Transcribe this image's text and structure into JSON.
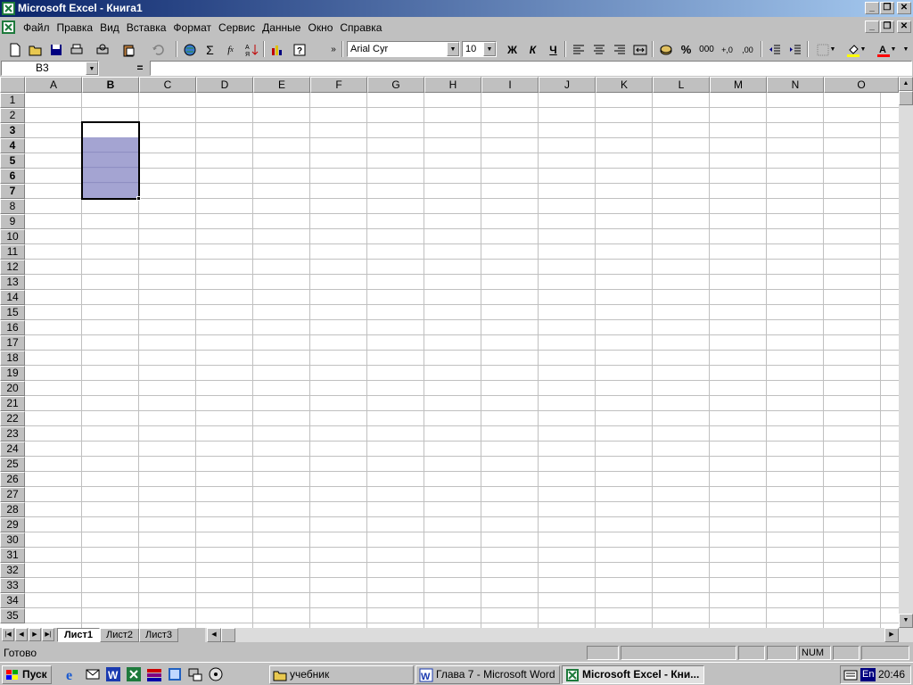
{
  "window": {
    "title": "Microsoft Excel - Книга1"
  },
  "menu": {
    "items": [
      "Файл",
      "Правка",
      "Вид",
      "Вставка",
      "Формат",
      "Сервис",
      "Данные",
      "Окно",
      "Справка"
    ]
  },
  "toolbar": {
    "font_name": "Arial Cyr",
    "font_size": "10",
    "bold_label": "Ж",
    "italic_label": "К",
    "underline_label": "Ч",
    "sum_label": "Σ",
    "percent_label": "%",
    "thousands_label": "000",
    "inc_decimal_label": "+,0",
    "dec_decimal_label": ",00",
    "more_label": "»"
  },
  "formula_bar": {
    "name_box": "B3",
    "equals": "=",
    "value": ""
  },
  "columns": [
    "A",
    "B",
    "C",
    "D",
    "E",
    "F",
    "G",
    "H",
    "I",
    "J",
    "K",
    "L",
    "M",
    "N",
    "O"
  ],
  "rows": [
    "1",
    "2",
    "3",
    "4",
    "5",
    "6",
    "7",
    "8",
    "9",
    "10",
    "11",
    "12",
    "13",
    "14",
    "15",
    "16",
    "17",
    "18",
    "19",
    "20",
    "21",
    "22",
    "23",
    "24",
    "25",
    "26",
    "27",
    "28",
    "29",
    "30",
    "31",
    "32",
    "33",
    "34",
    "35"
  ],
  "selection": {
    "active_cell": "B3",
    "range": "B3:B7",
    "selected_column": "B",
    "selected_rows": [
      "3",
      "4",
      "5",
      "6",
      "7"
    ]
  },
  "sheets": {
    "tabs": [
      "Лист1",
      "Лист2",
      "Лист3"
    ],
    "active": "Лист1"
  },
  "status": {
    "text": "Готово",
    "num": "NUM"
  },
  "taskbar": {
    "start_label": "Пуск",
    "tasks": [
      "учебник",
      "Глава 7 - Microsoft Word",
      "Microsoft Excel - Кни..."
    ],
    "lang": "En",
    "clock": "20:46"
  },
  "colors": {
    "title_start": "#0a246a",
    "title_end": "#a6caf0",
    "selection_fill": "#a0a0d0"
  }
}
